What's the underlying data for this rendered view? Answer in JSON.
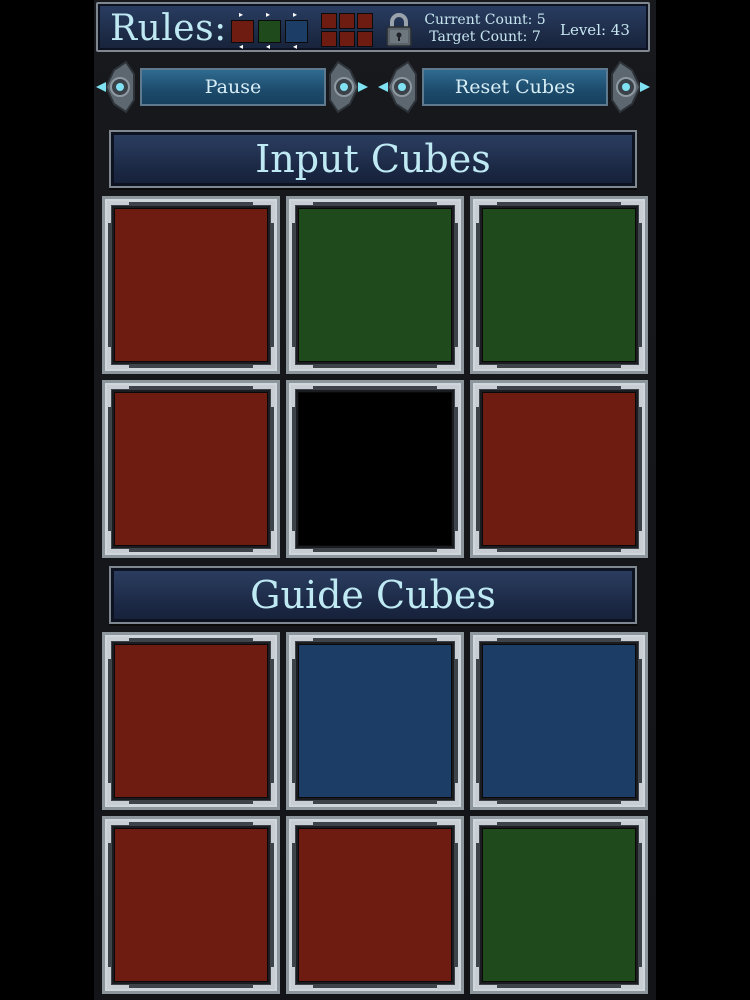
{
  "colors": {
    "red": "#6e1c12",
    "green": "#1f4a1c",
    "blue": "#1b3d66",
    "black": "#000000",
    "header_text": "#bfeaf4"
  },
  "rules": {
    "label": "Rules:",
    "sequence": [
      "red",
      "green",
      "blue"
    ],
    "target_pattern": [
      "red",
      "red",
      "red",
      "red",
      "red",
      "red"
    ],
    "lock_icon": "padlock-icon"
  },
  "status": {
    "current_count": "Current Count: 5",
    "target_count": "Target Count: 7",
    "level": "Level: 43"
  },
  "buttons": {
    "pause": "Pause",
    "reset": "Reset Cubes"
  },
  "input_section": {
    "title": "Input Cubes",
    "cubes": [
      "red",
      "green",
      "green",
      "red",
      "black",
      "red"
    ]
  },
  "guide_section": {
    "title": "Guide Cubes",
    "cubes": [
      "red",
      "blue",
      "blue",
      "red",
      "red",
      "green"
    ]
  }
}
